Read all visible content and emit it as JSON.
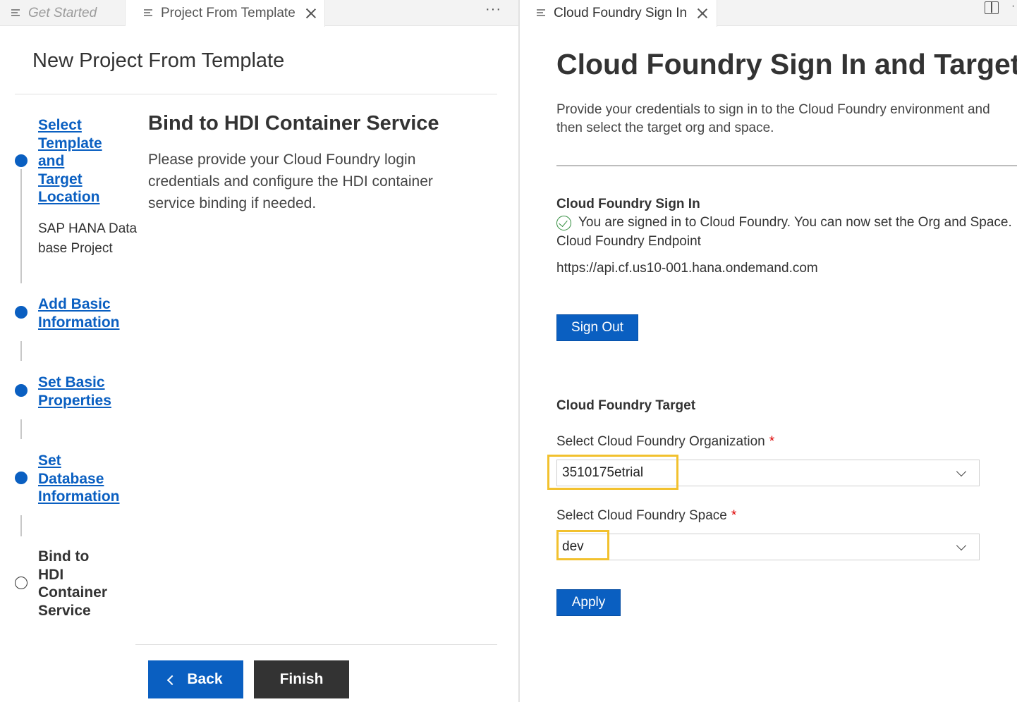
{
  "tabs_left": {
    "get_started": "Get Started",
    "project_from_template": "Project From Template",
    "more": "···"
  },
  "tabs_right": {
    "cf_sign_in": "Cloud Foundry Sign In",
    "more": "·"
  },
  "wizard": {
    "title": "New Project From Template",
    "steps": [
      {
        "label_lines": [
          "Select",
          "Template",
          "and",
          "Target",
          "Location"
        ],
        "status": "completed",
        "sub": "SAP HANA Data base Project"
      },
      {
        "label_lines": [
          "Add Basic",
          "Information"
        ],
        "status": "completed"
      },
      {
        "label_lines": [
          "Set Basic",
          "Properties"
        ],
        "status": "completed"
      },
      {
        "label_lines": [
          "Set",
          "Database",
          "Information"
        ],
        "status": "completed"
      },
      {
        "label_lines": [
          "Bind to",
          "HDI",
          "Container",
          "Service"
        ],
        "status": "current"
      }
    ],
    "section_title": "Bind to HDI Container Service",
    "section_desc": "Please provide your Cloud Foundry login credentials and configure the HDI container service binding if needed.",
    "back_label": "Back",
    "finish_label": "Finish"
  },
  "cf": {
    "title": "Cloud Foundry Sign In and Targets",
    "desc": "Provide your credentials to sign in to the Cloud Foundry environment and then select the target org and space.",
    "signin_heading": "Cloud Foundry Sign In",
    "status_text": "You are signed in to Cloud Foundry. You can now set the Org and Space.",
    "endpoint_label": "Cloud Foundry Endpoint",
    "endpoint_value": "https://api.cf.us10-001.hana.ondemand.com",
    "sign_out_label": "Sign Out",
    "target_heading": "Cloud Foundry Target",
    "org_label": "Select Cloud Foundry Organization",
    "org_value": "3510175etrial",
    "space_label": "Select Cloud Foundry Space",
    "space_value": "dev",
    "required_mark": "*",
    "apply_label": "Apply"
  },
  "colors": {
    "accent": "#0a5fc1",
    "dark_button": "#333333",
    "highlight": "#f2c12e",
    "success": "#2e8b3a",
    "required": "#dd0000"
  },
  "icons": [
    "file-icon",
    "close-icon",
    "more-icon",
    "split-editor-icon",
    "check-circle-icon",
    "chevron-left-icon",
    "chevron-down-icon"
  ]
}
